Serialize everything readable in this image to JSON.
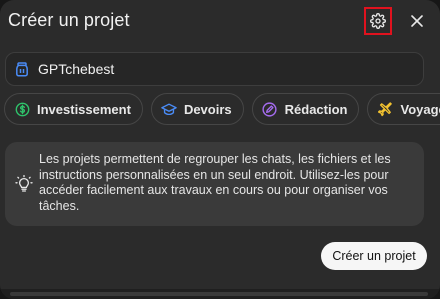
{
  "dialog": {
    "title": "Créer un projet",
    "settings_icon": "gear-icon",
    "close_icon": "close-icon"
  },
  "name_field": {
    "value": "GPTchebest",
    "icon": "jar-icon",
    "icon_color": "#4a8cf7"
  },
  "chips": [
    {
      "label": "Investissement",
      "icon": "dollar-icon",
      "color": "#2fc26b"
    },
    {
      "label": "Devoirs",
      "icon": "graduation-cap-icon",
      "color": "#4a8cf7"
    },
    {
      "label": "Rédaction",
      "icon": "pen-icon",
      "color": "#a56cf0"
    },
    {
      "label": "Voyages",
      "icon": "plane-icon",
      "color": "#f2c230"
    }
  ],
  "info": {
    "icon": "lightbulb-icon",
    "text": "Les projets permettent de regrouper les chats, les fichiers et les instructions personnalisées en un seul endroit. Utilisez-les pour accéder facilement aux travaux en cours ou pour organiser vos tâches."
  },
  "create_button": {
    "label": "Créer un projet"
  },
  "colors": {
    "dialog_bg": "#2b2b2b",
    "highlight_border": "#e0121e"
  }
}
